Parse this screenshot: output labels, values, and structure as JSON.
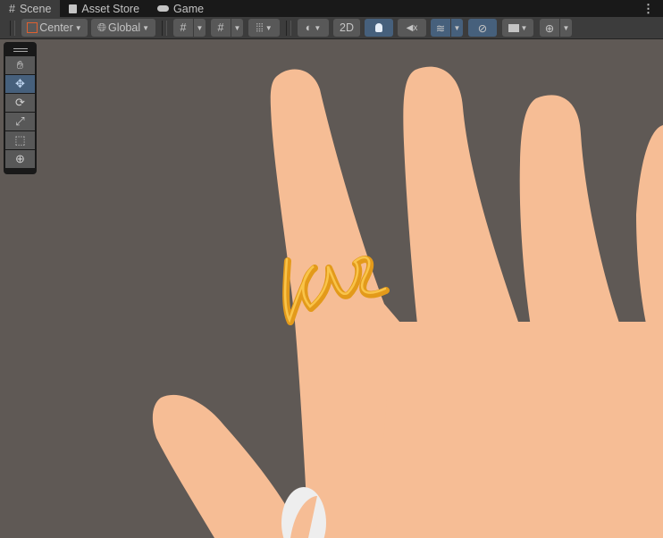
{
  "tabs": [
    {
      "label": "Scene",
      "icon": "grid-icon",
      "active": true
    },
    {
      "label": "Asset Store",
      "icon": "bag-icon"
    },
    {
      "label": "Game",
      "icon": "gamepad-icon"
    }
  ],
  "toolbar": {
    "pivot": "Center",
    "space": "Global",
    "mode_2d": "2D"
  },
  "tools": [
    "hand",
    "move",
    "rotate",
    "scale",
    "rect",
    "transform"
  ],
  "colors": {
    "accent": "#46607c",
    "viewport": "#5f5955",
    "skin": "#f6bd95",
    "ring": "#e39a1a"
  }
}
